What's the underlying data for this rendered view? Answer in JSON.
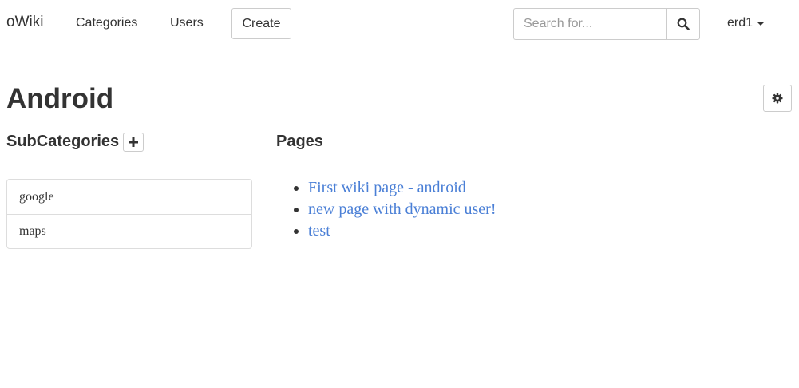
{
  "navbar": {
    "brand": "oWiki",
    "links": [
      "Categories",
      "Users"
    ],
    "create_label": "Create",
    "search": {
      "placeholder": "Search for...",
      "value": ""
    },
    "user_label": "erd1"
  },
  "page": {
    "title": "Android"
  },
  "subcategories": {
    "heading": "SubCategories",
    "items": [
      "google",
      "maps"
    ]
  },
  "pages": {
    "heading": "Pages",
    "items": [
      "First wiki page - android",
      "new page with dynamic user!",
      "test"
    ]
  },
  "icons": {
    "search": "search-icon",
    "settings": "gear-icon",
    "add": "plus-icon",
    "dropdown": "caret-down-icon"
  },
  "colors": {
    "link": "#4a7fd6",
    "text": "#333333",
    "border": "#dddddd"
  }
}
